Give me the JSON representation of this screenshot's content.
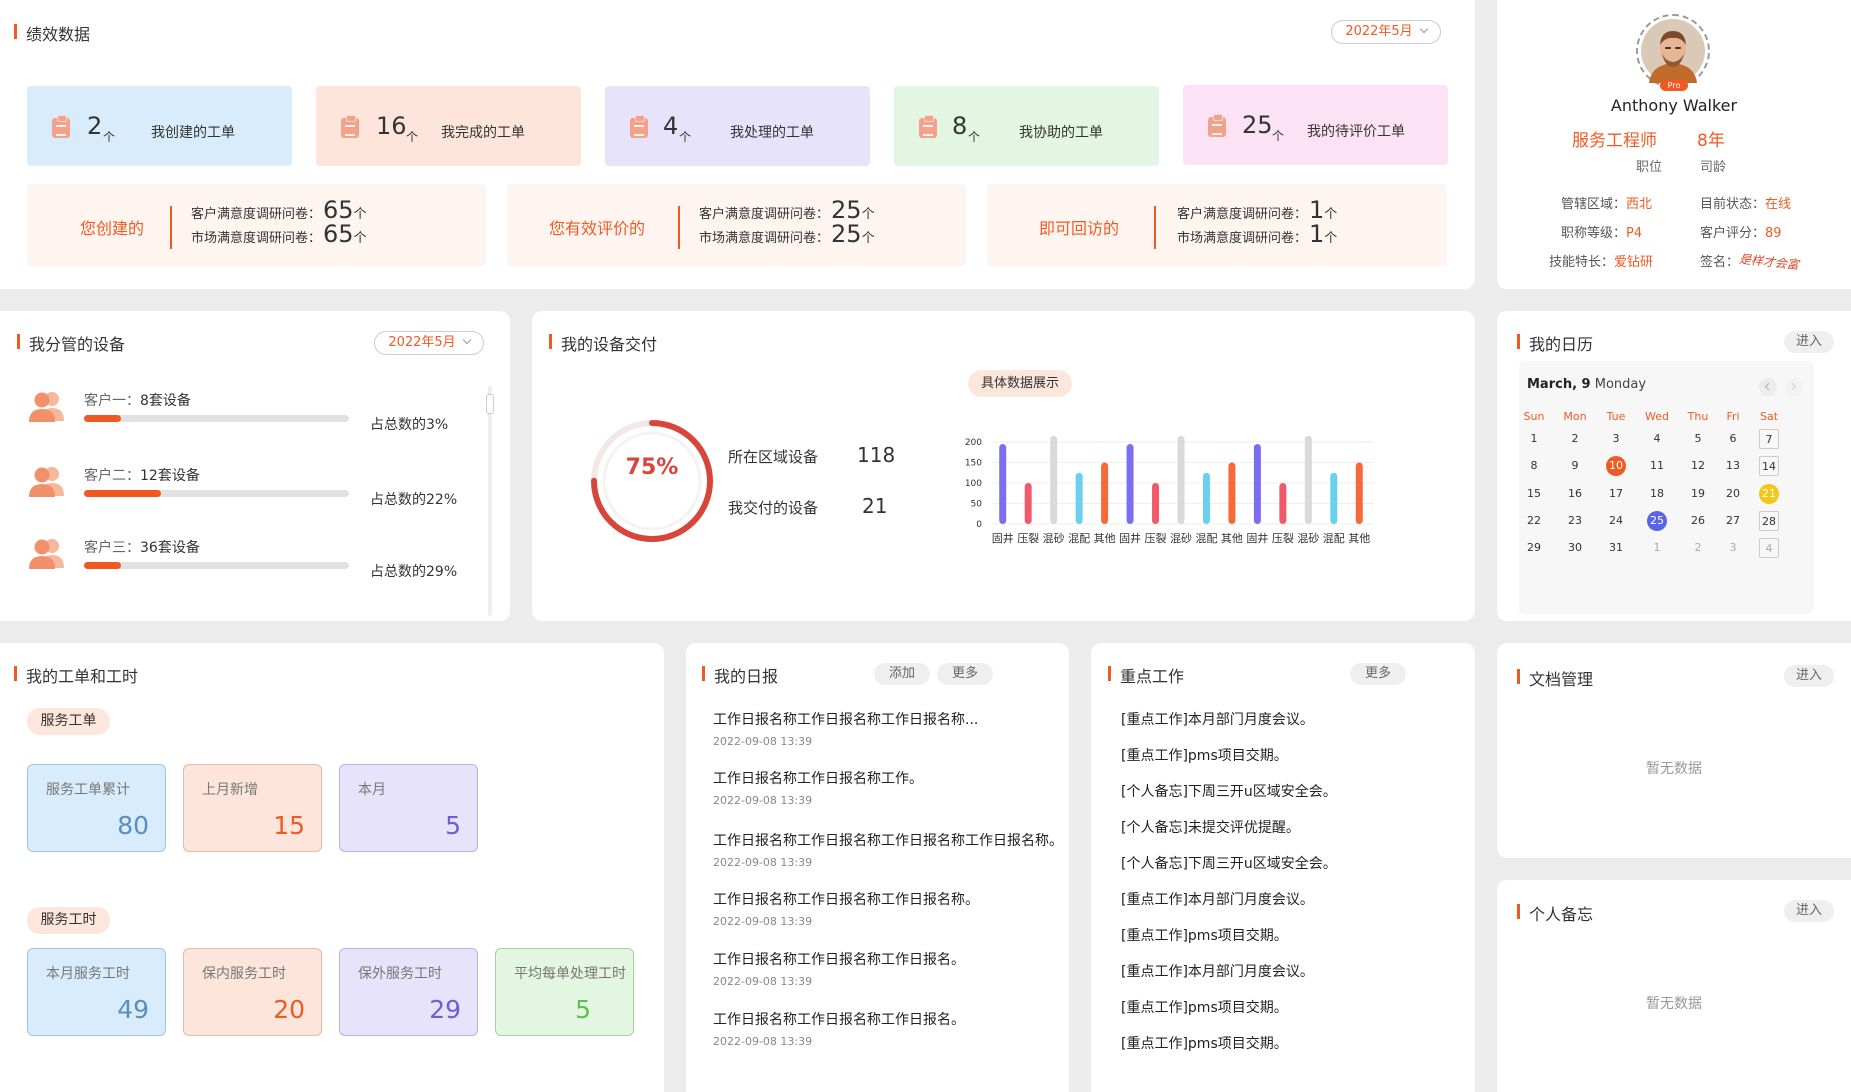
{
  "performance": {
    "title": "绩效数据",
    "month": "2022年5月",
    "stats": [
      {
        "value": "2",
        "unit": "个",
        "label": "我创建的工单",
        "bg": "#d8ecfb",
        "icon_color": "#f2a18a"
      },
      {
        "value": "16",
        "unit": "个",
        "label": "我完成的工单",
        "bg": "#fde5db",
        "icon_color": "#f2a18a"
      },
      {
        "value": "4",
        "unit": "个",
        "label": "我处理的工单",
        "bg": "#e6e3fb",
        "icon_color": "#f2a18a"
      },
      {
        "value": "8",
        "unit": "个",
        "label": "我协助的工单",
        "bg": "#e3f6e1",
        "icon_color": "#f2a18a"
      },
      {
        "value": "25",
        "unit": "个",
        "label": "我的待评价工单",
        "bg": "#fbe3f5",
        "icon_color": "#f2a18a"
      }
    ],
    "summaries": [
      {
        "name": "您创建的",
        "rows": [
          {
            "label": "客户满意度调研问卷：",
            "value": "65",
            "unit": "个"
          },
          {
            "label": "市场满意度调研问卷：",
            "value": "65",
            "unit": "个"
          }
        ]
      },
      {
        "name": "您有效评价的",
        "rows": [
          {
            "label": "客户满意度调研问卷：",
            "value": "25",
            "unit": "个"
          },
          {
            "label": "市场满意度调研问卷：",
            "value": "25",
            "unit": "个"
          }
        ]
      },
      {
        "name": "即可回访的",
        "rows": [
          {
            "label": "客户满意度调研问卷：",
            "value": "1",
            "unit": "个"
          },
          {
            "label": "市场满意度调研问卷：",
            "value": "1",
            "unit": "个"
          }
        ]
      }
    ]
  },
  "profile": {
    "name": "Anthony Walker",
    "badge": "Pro",
    "role": "服务工程师",
    "role_caption": "职位",
    "years": "8年",
    "years_caption": "司龄",
    "fields": [
      {
        "label": "管辖区域：",
        "value": "西北"
      },
      {
        "label": "目前状态：",
        "value": "在线"
      },
      {
        "label": "职称等级：",
        "value": "P4"
      },
      {
        "label": "客户评分：",
        "value": "89"
      },
      {
        "label": "技能特长：",
        "value": "爱钻研"
      },
      {
        "label": "签名：",
        "value": "是样才会富"
      }
    ]
  },
  "devices": {
    "title": "我分管的设备",
    "month": "2022年5月",
    "customers": [
      {
        "label": "客户一：",
        "count": "8套设备",
        "share": "占总数的3%",
        "fill_pct": 14
      },
      {
        "label": "客户二：",
        "count": "12套设备",
        "share": "占总数的22%",
        "fill_pct": 29
      },
      {
        "label": "客户三：",
        "count": "36套设备",
        "share": "占总数的29%",
        "fill_pct": 14
      }
    ]
  },
  "delivery": {
    "title": "我的设备交付",
    "percent": "75%",
    "percent_value": 75,
    "area_label": "所在区域设备",
    "area_value": "118",
    "delivered_label": "我交付的设备",
    "delivered_value": "21",
    "chart_title": "具体数据展示"
  },
  "chart_data": {
    "type": "bar",
    "title": "具体数据展示",
    "categories": [
      "固井",
      "压裂",
      "混砂",
      "混配",
      "其他",
      "固井",
      "压裂",
      "混砂",
      "混配",
      "其他",
      "固井",
      "压裂",
      "混砂",
      "混配",
      "其他"
    ],
    "values": [
      195,
      100,
      215,
      125,
      150,
      195,
      100,
      215,
      125,
      150,
      195,
      100,
      215,
      125,
      150
    ],
    "colors": [
      "#7b6ff0",
      "#f25a6a",
      "#d9d9d9",
      "#6ad0f0",
      "#f8693a",
      "#7b6ff0",
      "#f25a6a",
      "#d9d9d9",
      "#6ad0f0",
      "#f8693a",
      "#7b6ff0",
      "#f25a6a",
      "#d9d9d9",
      "#6ad0f0",
      "#f8693a"
    ],
    "yticks": [
      "200",
      "150",
      "100",
      "50",
      "0"
    ],
    "ylim": [
      0,
      200
    ],
    "grid": true
  },
  "calendar": {
    "title": "我的日历",
    "enter": "进入",
    "month_label": "March, 9",
    "weekday": "Monday",
    "prev_icon": "chevron-left-icon",
    "next_icon": "chevron-right-icon",
    "weekdays": [
      "Sun",
      "Mon",
      "Tue",
      "Wed",
      "Thu",
      "Fri",
      "Sat"
    ],
    "weeks": [
      [
        "1",
        "2",
        "3",
        "4",
        "5",
        "6",
        "7"
      ],
      [
        "8",
        "9",
        "10",
        "11",
        "12",
        "13",
        "14"
      ],
      [
        "15",
        "16",
        "17",
        "18",
        "19",
        "20",
        "21"
      ],
      [
        "22",
        "23",
        "24",
        "25",
        "26",
        "27",
        "28"
      ],
      [
        "29",
        "30",
        "31",
        "1",
        "2",
        "3",
        "4"
      ]
    ],
    "highlights": {
      "10": {
        "color": "#f05a22",
        "badge": "3"
      },
      "21": {
        "color": "#f5c518",
        "badge": "1"
      },
      "25": {
        "color": "#5b63e8",
        "badge": "2"
      }
    }
  },
  "workorders": {
    "title": "我的工单和工时",
    "service_tag": "服务工单",
    "hours_tag": "服务工时",
    "orders": [
      {
        "label": "服务工单累计",
        "value": "80",
        "bg": "#d8ecfb",
        "border": "#9cc6e8",
        "color": "#5a8fba"
      },
      {
        "label": "上月新增",
        "value": "15",
        "bg": "#fde5db",
        "border": "#e8b9a6",
        "color": "#f05a22"
      },
      {
        "label": "本月",
        "value": "5",
        "bg": "#e6e3fb",
        "border": "#b8b1e6",
        "color": "#6e5fd0"
      }
    ],
    "hours": [
      {
        "label": "本月服务工时",
        "value": "49",
        "bg": "#d8ecfb",
        "border": "#9cc6e8",
        "color": "#5a8fba"
      },
      {
        "label": "保内服务工时",
        "value": "20",
        "bg": "#fde5db",
        "border": "#e8b9a6",
        "color": "#f05a22"
      },
      {
        "label": "保外服务工时",
        "value": "29",
        "bg": "#e6e3fb",
        "border": "#b8b1e6",
        "color": "#6e5fd0"
      },
      {
        "label": "平均每单处理工时",
        "value": "5",
        "bg": "#e3f6e1",
        "border": "#9fd69a",
        "color": "#5cc04f"
      }
    ]
  },
  "daily": {
    "title": "我的日报",
    "add": "添加",
    "more": "更多",
    "items": [
      {
        "title": "工作日报名称工作日报名称工作日报名称...",
        "date": "2022-09-08 13:39"
      },
      {
        "title": "工作日报名称工作日报名称工作。",
        "date": "2022-09-08 13:39"
      },
      {
        "title": "工作日报名称工作日报名称工作日报名称工作日报名称。",
        "date": "2022-09-08 13:39"
      },
      {
        "title": "工作日报名称工作日报名称工作日报名称。",
        "date": "2022-09-08 13:39"
      },
      {
        "title": "工作日报名称工作日报名称工作日报名。",
        "date": "2022-09-08 13:39"
      },
      {
        "title": "工作日报名称工作日报名称工作日报名。",
        "date": "2022-09-08 13:39"
      }
    ]
  },
  "key_work": {
    "title": "重点工作",
    "more": "更多",
    "items": [
      "[重点工作]本月部门月度会议。",
      "[重点工作]pms项目交期。",
      "[个人备忘]下周三开u区域安全会。",
      "[个人备忘]未提交评优提醒。",
      "[个人备忘]下周三开u区域安全会。",
      "[重点工作]本月部门月度会议。",
      "[重点工作]pms项目交期。",
      "[重点工作]本月部门月度会议。",
      "[重点工作]pms项目交期。",
      "[重点工作]pms项目交期。"
    ]
  },
  "docs": {
    "title": "文档管理",
    "enter": "进入",
    "empty": "暂无数据"
  },
  "memo": {
    "title": "个人备忘",
    "enter": "进入",
    "empty": "暂无数据"
  }
}
